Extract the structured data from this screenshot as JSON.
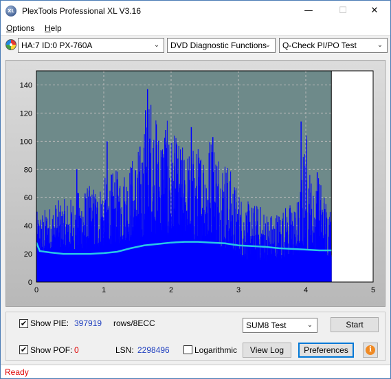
{
  "window": {
    "title": "PlexTools Professional XL V3.16",
    "icon_text": "XL",
    "minimize_glyph": "—",
    "maximize_glyph": "☐",
    "close_glyph": "✕"
  },
  "menu": {
    "options": {
      "mnemonic": "O",
      "rest": "ptions"
    },
    "help": {
      "mnemonic": "H",
      "rest": "elp"
    }
  },
  "toolbar": {
    "drive_select": "HA:7 ID:0  PX-760A",
    "function_select": "DVD Diagnostic Functions",
    "test_select": "Q-Check PI/PO Test",
    "dropdown_glyph": "⌄"
  },
  "chart_data": {
    "type": "bar",
    "xlim": [
      0,
      5
    ],
    "ylim": [
      0,
      150
    ],
    "x_ticks": [
      "0",
      "1",
      "2",
      "3",
      "4",
      "5"
    ],
    "y_ticks": [
      "0",
      "20",
      "40",
      "60",
      "80",
      "100",
      "120",
      "140"
    ],
    "grid": true,
    "data_end_x": 4.38,
    "colors": {
      "bars": "#0000ff",
      "line": "#29c8e6",
      "background": "#6e8a8a",
      "grid": "#bbbbbb"
    },
    "envelope": {
      "x": [
        0,
        0.1,
        0.3,
        0.5,
        0.7,
        0.9,
        1.1,
        1.3,
        1.5,
        1.6,
        1.7,
        1.8,
        1.9,
        2.0,
        2.2,
        2.4,
        2.6,
        2.8,
        2.95,
        3.1,
        3.3,
        3.5,
        3.7,
        3.9,
        4.0,
        4.1,
        4.2,
        4.3,
        4.38
      ],
      "max": [
        50,
        52,
        58,
        60,
        68,
        70,
        78,
        82,
        95,
        110,
        137,
        112,
        120,
        108,
        96,
        98,
        110,
        92,
        72,
        58,
        56,
        50,
        55,
        60,
        114,
        66,
        78,
        62,
        55
      ],
      "min": [
        18,
        20,
        22,
        22,
        23,
        24,
        26,
        28,
        30,
        30,
        32,
        32,
        30,
        31,
        30,
        28,
        27,
        24,
        20,
        16,
        15,
        14,
        17,
        18,
        22,
        22,
        20,
        19,
        18
      ]
    },
    "spikes": [
      {
        "x": 1.65,
        "y": 137
      },
      {
        "x": 1.62,
        "y": 122
      },
      {
        "x": 1.78,
        "y": 112
      },
      {
        "x": 2.3,
        "y": 110
      },
      {
        "x": 1.92,
        "y": 108
      },
      {
        "x": 2.62,
        "y": 103
      },
      {
        "x": 1.05,
        "y": 100
      },
      {
        "x": 3.93,
        "y": 114
      },
      {
        "x": 4.17,
        "y": 78
      },
      {
        "x": 0.6,
        "y": 80
      }
    ],
    "pif_line": {
      "x": [
        0,
        0.05,
        0.2,
        0.4,
        0.6,
        0.8,
        1.0,
        1.2,
        1.4,
        1.6,
        1.8,
        2.0,
        2.2,
        2.4,
        2.6,
        2.8,
        3.0,
        3.2,
        3.4,
        3.6,
        3.8,
        4.0,
        4.2,
        4.38
      ],
      "y": [
        28,
        22,
        21,
        20,
        20,
        20,
        20.5,
        21.5,
        24,
        26,
        27,
        28,
        28.5,
        28.5,
        28,
        27.5,
        26,
        25.5,
        25,
        24,
        23.5,
        23,
        22.5,
        22.5
      ]
    }
  },
  "controls": {
    "show_pie_label": "Show PIE:",
    "show_pie_checked": true,
    "pie_value": "397919",
    "pie_unit": "rows/8ECC",
    "show_pof_label": "Show POF:",
    "show_pof_checked": true,
    "pof_value": "0",
    "lsn_label": "LSN:",
    "lsn_value": "2298496",
    "logarithmic_label": "Logarithmic",
    "logarithmic_checked": false,
    "test_mode_select": "SUM8 Test",
    "start_label": "Start",
    "view_log_label": "View Log",
    "preferences_label": "Preferences",
    "info_glyph": "i",
    "check_glyph": "✔"
  },
  "status": {
    "text": "Ready"
  }
}
